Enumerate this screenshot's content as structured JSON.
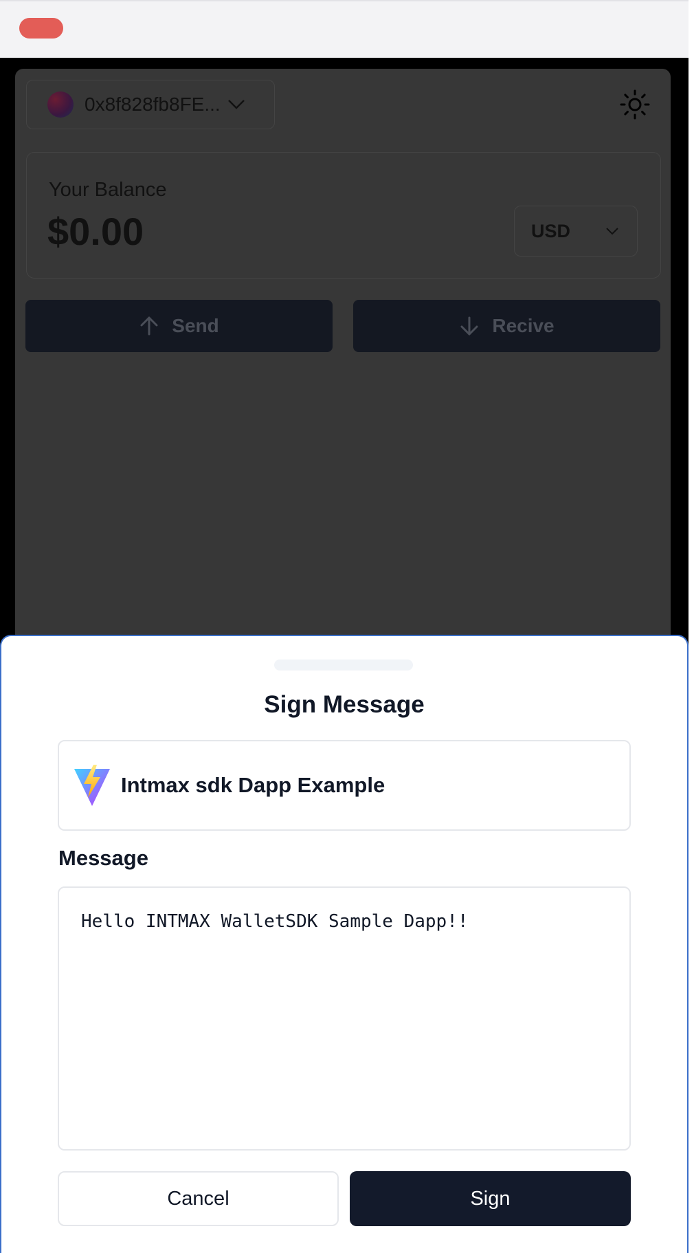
{
  "colors": {
    "close_button": "#e35d57",
    "overlay_bg": "#373737",
    "sheet_border": "#3b6fc9",
    "primary_button": "#131a2b"
  },
  "wallet": {
    "address": "0x8f828fb8FE...",
    "balance_label": "Your Balance",
    "balance_value": "$0.00",
    "currency": "USD",
    "send_label": "Send",
    "receive_label": "Recive"
  },
  "sign_sheet": {
    "title": "Sign Message",
    "dapp_name": "Intmax sdk Dapp Example",
    "message_label": "Message",
    "message_text": "Hello INTMAX WalletSDK Sample Dapp!!",
    "cancel_label": "Cancel",
    "sign_label": "Sign"
  },
  "icons": {
    "avatar": "avatar",
    "address_dropdown": "chevron-down-icon",
    "theme_toggle": "sun-icon",
    "currency_dropdown": "chevron-down-icon",
    "send": "arrow-up-icon",
    "receive": "arrow-down-icon",
    "dapp_logo": "vite-logo-icon"
  }
}
